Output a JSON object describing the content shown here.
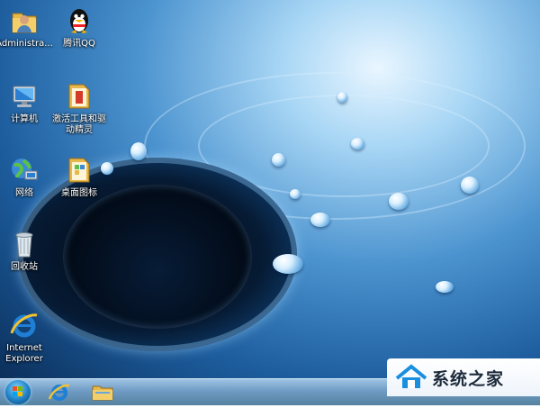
{
  "desktop_icons": [
    {
      "label": "Administra...",
      "icon": "user-folder-icon"
    },
    {
      "label": "腾讯QQ",
      "icon": "qq-penguin-icon"
    },
    {
      "label": "计算机",
      "icon": "computer-icon"
    },
    {
      "label": "激活工具和驱\n动精灵",
      "icon": "folder-icon"
    },
    {
      "label": "网络",
      "icon": "network-icon"
    },
    {
      "label": "桌面图标",
      "icon": "folder-icon"
    },
    {
      "label": "回收站",
      "icon": "recycle-bin-icon"
    },
    {
      "label": "Internet\nExplorer",
      "icon": "internet-explorer-icon"
    }
  ],
  "taskbar": {
    "start": "windows-start-orb-icon",
    "pinned": [
      "internet-explorer-icon",
      "file-explorer-icon"
    ]
  },
  "watermark": {
    "text": "系统之家"
  },
  "colors": {
    "taskbar": "#6f9bc4",
    "wallpaper": "#1d5d9e",
    "folder": "#e7b84a"
  }
}
